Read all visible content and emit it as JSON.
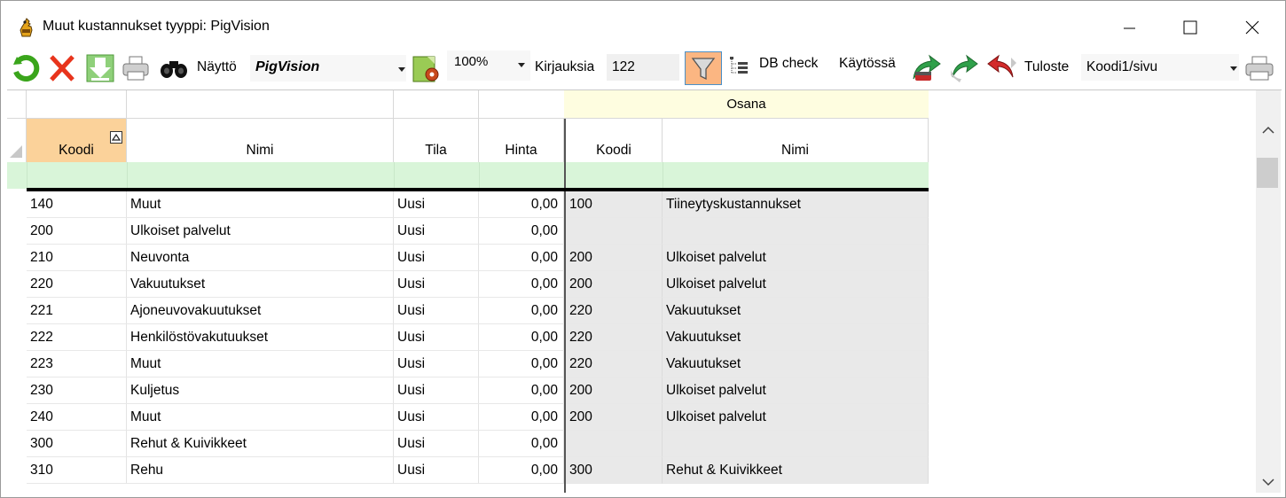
{
  "window": {
    "title": "Muut kustannukset tyyppi: PigVision"
  },
  "toolbar": {
    "display_label": "Näyttö",
    "display_value": "PigVision",
    "zoom_value": "100%",
    "records_label": "Kirjauksia",
    "records_value": "122",
    "db_check_label": "DB check",
    "in_use_label": "Käytössä",
    "print_label": "Tuloste",
    "print_value": "Koodi1/sivu"
  },
  "grid": {
    "band_label": "Osana",
    "columns": [
      "Koodi",
      "Nimi",
      "Tila",
      "Hinta",
      "Koodi",
      "Nimi"
    ],
    "rows": [
      {
        "koodi": "140",
        "nimi": "Muut",
        "tila": "Uusi",
        "hinta": "0,00",
        "osa_koodi": "100",
        "osa_nimi": "Tiineytyskustannukset"
      },
      {
        "koodi": "200",
        "nimi": "Ulkoiset palvelut",
        "tila": "Uusi",
        "hinta": "0,00",
        "osa_koodi": "",
        "osa_nimi": ""
      },
      {
        "koodi": "210",
        "nimi": "Neuvonta",
        "tila": "Uusi",
        "hinta": "0,00",
        "osa_koodi": "200",
        "osa_nimi": "Ulkoiset palvelut"
      },
      {
        "koodi": "220",
        "nimi": "Vakuutukset",
        "tila": "Uusi",
        "hinta": "0,00",
        "osa_koodi": "200",
        "osa_nimi": "Ulkoiset palvelut"
      },
      {
        "koodi": "221",
        "nimi": "Ajoneuvovakuutukset",
        "tila": "Uusi",
        "hinta": "0,00",
        "osa_koodi": "220",
        "osa_nimi": "Vakuutukset"
      },
      {
        "koodi": "222",
        "nimi": "Henkilöstövakutuukset",
        "tila": "Uusi",
        "hinta": "0,00",
        "osa_koodi": "220",
        "osa_nimi": "Vakuutukset"
      },
      {
        "koodi": "223",
        "nimi": "Muut",
        "tila": "Uusi",
        "hinta": "0,00",
        "osa_koodi": "220",
        "osa_nimi": "Vakuutukset"
      },
      {
        "koodi": "230",
        "nimi": "Kuljetus",
        "tila": "Uusi",
        "hinta": "0,00",
        "osa_koodi": "200",
        "osa_nimi": "Ulkoiset palvelut"
      },
      {
        "koodi": "240",
        "nimi": "Muut",
        "tila": "Uusi",
        "hinta": "0,00",
        "osa_koodi": "200",
        "osa_nimi": "Ulkoiset palvelut"
      },
      {
        "koodi": "300",
        "nimi": "Rehut & Kuivikkeet",
        "tila": "Uusi",
        "hinta": "0,00",
        "osa_koodi": "",
        "osa_nimi": ""
      },
      {
        "koodi": "310",
        "nimi": "Rehu",
        "tila": "Uusi",
        "hinta": "0,00",
        "osa_koodi": "300",
        "osa_nimi": "Rehut & Kuivikkeet"
      }
    ]
  },
  "colors": {
    "sorted_header": "#fbd29a",
    "band_header": "#fefde0",
    "filter_row": "#d9f5d9",
    "gray_column": "#e9e9e9"
  }
}
